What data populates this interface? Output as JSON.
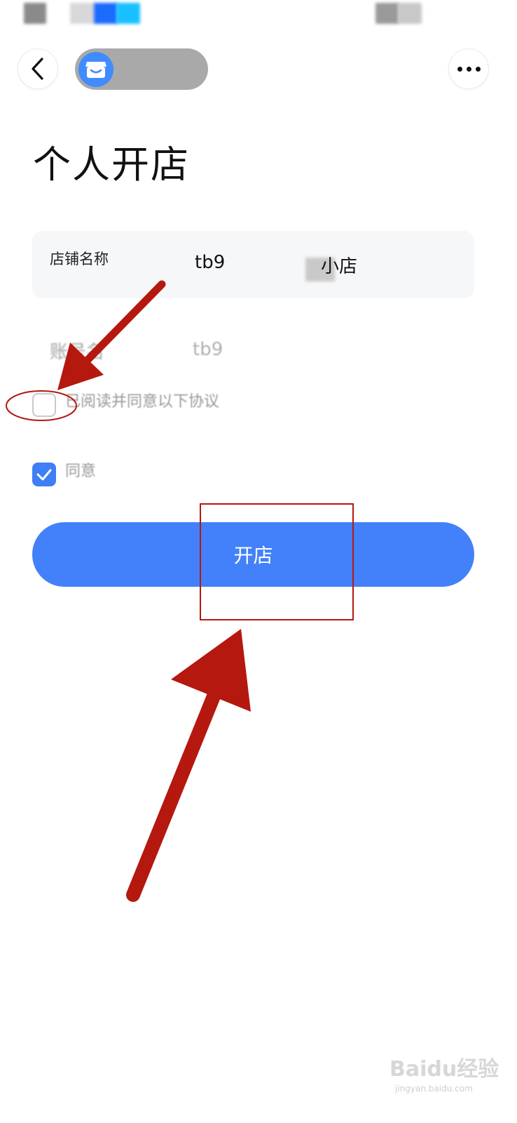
{
  "header": {
    "more_label": "•••"
  },
  "page": {
    "title": "个人开店"
  },
  "form": {
    "shop_name_label": "店铺名称",
    "shop_name_prefix": "tb9",
    "shop_name_suffix": "小店",
    "account_label": "账号名",
    "account_value": "tb9"
  },
  "agreements": {
    "read_agree_text": "已阅读并同意以下协议",
    "read_agree_checked": false,
    "bind_agree_text": "同意",
    "bind_agree_checked": true
  },
  "actions": {
    "open_shop_label": "开店"
  },
  "colors": {
    "primary": "#4281f9",
    "annotation_red": "#b5180f"
  },
  "watermark": {
    "text": "Baidu经验",
    "url_text": "jingyan.baidu.com"
  }
}
